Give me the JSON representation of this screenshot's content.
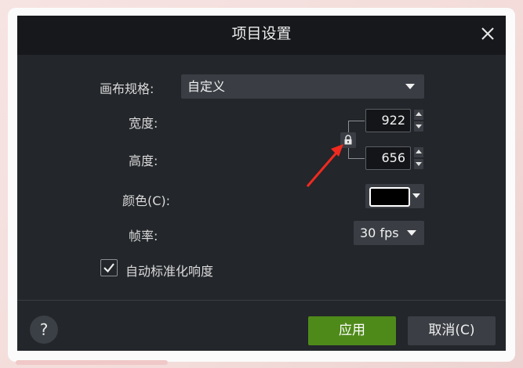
{
  "dialog": {
    "title": "项目设置",
    "close_icon": "close-icon"
  },
  "canvas_preset": {
    "label": "画布规格:",
    "value": "自定义"
  },
  "width": {
    "label": "宽度:",
    "value": "922"
  },
  "height": {
    "label": "高度:",
    "value": "656"
  },
  "aspect_lock_icon": "lock-icon",
  "annotation_arrow_color": "#f02a1f",
  "color": {
    "label": "颜色(C):",
    "swatch": "#000000"
  },
  "framerate": {
    "label": "帧率:",
    "value": "30 fps"
  },
  "auto_normalize": {
    "label": "自动标准化响度",
    "checked": true
  },
  "footer": {
    "help_label": "?",
    "apply_label": "应用",
    "cancel_label": "取消(C)"
  },
  "colors": {
    "dialog_bg": "#23262a",
    "titlebar_bg": "#16181b",
    "apply_bg": "#4e8a1a",
    "accent_arrow": "#f02a1f"
  }
}
